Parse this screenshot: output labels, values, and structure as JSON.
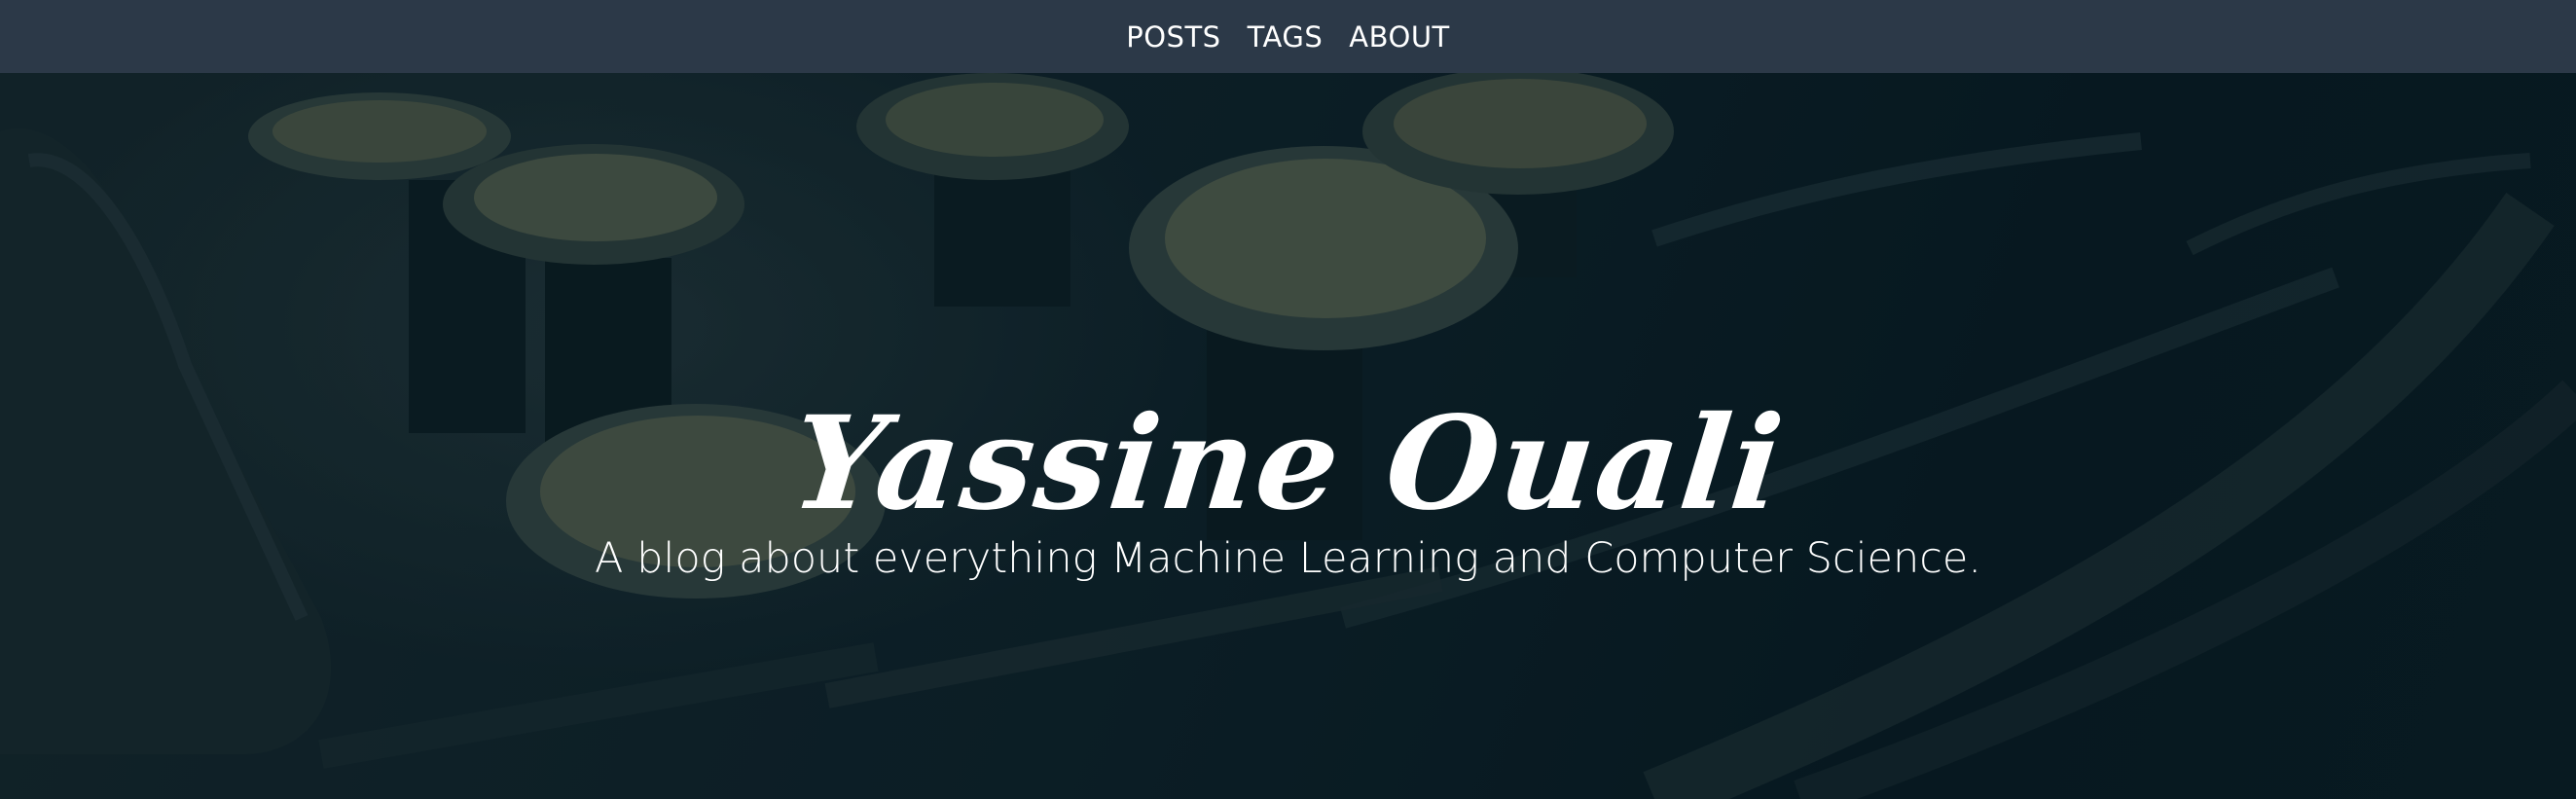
{
  "nav": {
    "items": [
      {
        "label": "POSTS"
      },
      {
        "label": "TAGS"
      },
      {
        "label": "ABOUT"
      }
    ]
  },
  "hero": {
    "title": "Yassine Ouali",
    "subtitle": "A blog about everything Machine Learning and Computer Science.",
    "background_image": "typewriter-keys-photo"
  },
  "colors": {
    "nav_background": "#2c3948",
    "nav_text": "#ffffff",
    "hero_overlay": "#0a1c22",
    "hero_text": "#ffffff"
  }
}
